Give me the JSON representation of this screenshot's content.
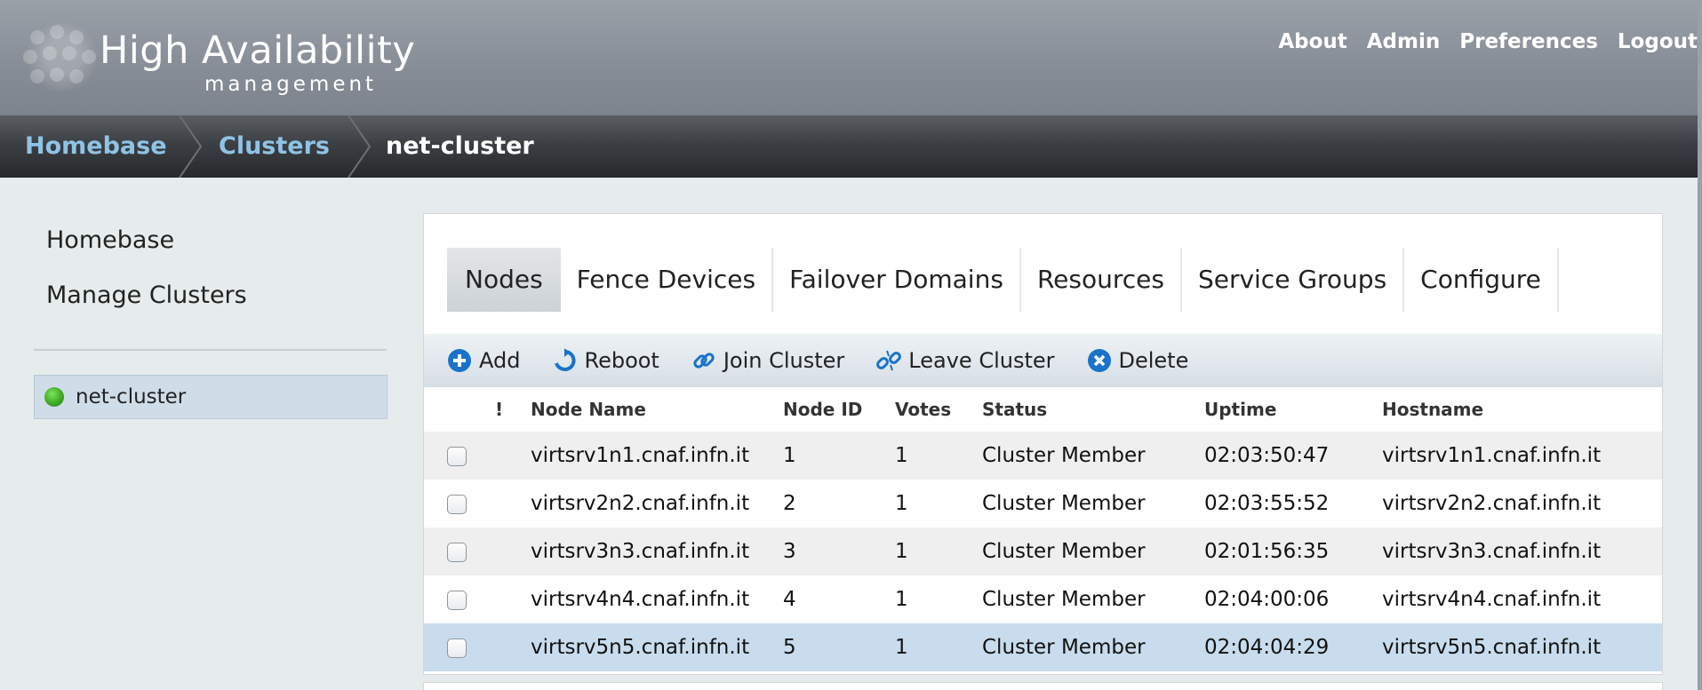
{
  "header": {
    "logo_title": "High Availability",
    "logo_subtitle": "management",
    "links": [
      "About",
      "Admin",
      "Preferences",
      "Logout"
    ]
  },
  "breadcrumb": {
    "items": [
      "Homebase",
      "Clusters",
      "net-cluster"
    ],
    "link_color": "#8fc3e6"
  },
  "sidebar": {
    "links": [
      "Homebase",
      "Manage Clusters"
    ],
    "clusters": [
      {
        "name": "net-cluster",
        "status_color": "#3caa22"
      }
    ]
  },
  "tabs": [
    "Nodes",
    "Fence Devices",
    "Failover Domains",
    "Resources",
    "Service Groups",
    "Configure"
  ],
  "active_tab": "Nodes",
  "toolbar": {
    "add": "Add",
    "reboot": "Reboot",
    "join": "Join Cluster",
    "leave": "Leave Cluster",
    "delete": "Delete"
  },
  "table": {
    "columns": [
      "!",
      "Node Name",
      "Node ID",
      "Votes",
      "Status",
      "Uptime",
      "Hostname"
    ],
    "rows": [
      {
        "node_name": "virtsrv1n1.cnaf.infn.it",
        "node_id": "1",
        "votes": "1",
        "status": "Cluster Member",
        "uptime": "02:03:50:47",
        "hostname": "virtsrv1n1.cnaf.infn.it"
      },
      {
        "node_name": "virtsrv2n2.cnaf.infn.it",
        "node_id": "2",
        "votes": "1",
        "status": "Cluster Member",
        "uptime": "02:03:55:52",
        "hostname": "virtsrv2n2.cnaf.infn.it"
      },
      {
        "node_name": "virtsrv3n3.cnaf.infn.it",
        "node_id": "3",
        "votes": "1",
        "status": "Cluster Member",
        "uptime": "02:01:56:35",
        "hostname": "virtsrv3n3.cnaf.infn.it"
      },
      {
        "node_name": "virtsrv4n4.cnaf.infn.it",
        "node_id": "4",
        "votes": "1",
        "status": "Cluster Member",
        "uptime": "02:04:00:06",
        "hostname": "virtsrv4n4.cnaf.infn.it"
      },
      {
        "node_name": "virtsrv5n5.cnaf.infn.it",
        "node_id": "5",
        "votes": "1",
        "status": "Cluster Member",
        "uptime": "02:04:04:29",
        "hostname": "virtsrv5n5.cnaf.infn.it"
      }
    ],
    "selected_row": 5
  },
  "colors": {
    "icon_blue": "#1a73c9",
    "selected_row": "#c8dced"
  }
}
